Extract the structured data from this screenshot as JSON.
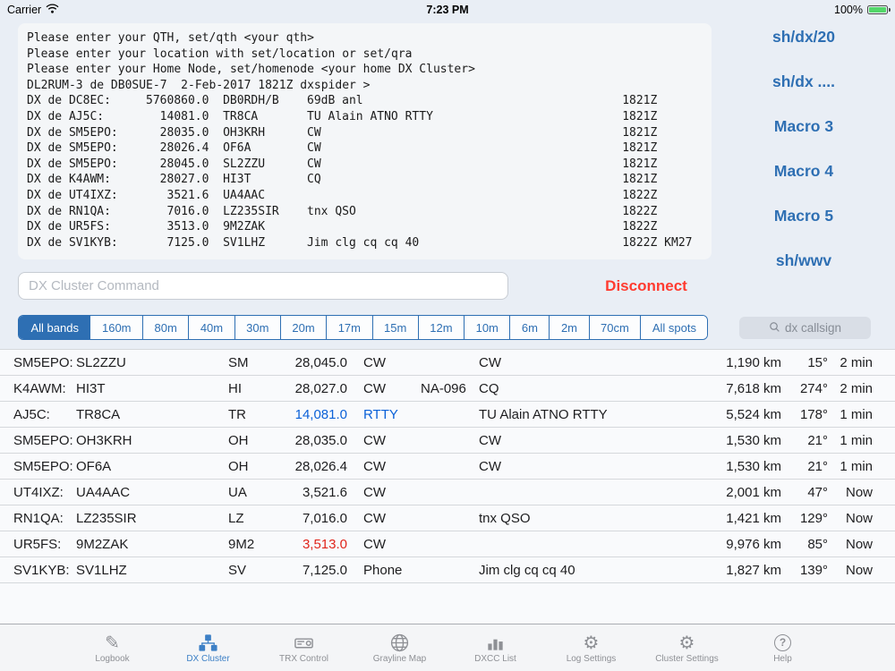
{
  "status_bar": {
    "carrier": "Carrier",
    "time": "7:23 PM",
    "battery_percent": "100%"
  },
  "terminal": {
    "intro_lines": [
      "Please enter your QTH, set/qth <your qth>",
      "Please enter your location with set/location or set/qra",
      "Please enter your Home Node, set/homenode <your home DX Cluster>",
      "DL2RUM-3 de DB0SUE-7  2-Feb-2017 1821Z dxspider >"
    ],
    "spot_lines": [
      {
        "head": "DX de DC8EC:",
        "freq": "5760860.0",
        "dx": "DB0RDH/B",
        "comment": "69dB anl",
        "time": "1821Z"
      },
      {
        "head": "DX de AJ5C:",
        "freq": "14081.0",
        "dx": "TR8CA",
        "comment": "TU Alain ATNO RTTY",
        "time": "1821Z"
      },
      {
        "head": "DX de SM5EPO:",
        "freq": "28035.0",
        "dx": "OH3KRH",
        "comment": "CW",
        "time": "1821Z"
      },
      {
        "head": "DX de SM5EPO:",
        "freq": "28026.4",
        "dx": "OF6A",
        "comment": "CW",
        "time": "1821Z"
      },
      {
        "head": "DX de SM5EPO:",
        "freq": "28045.0",
        "dx": "SL2ZZU",
        "comment": "CW",
        "time": "1821Z"
      },
      {
        "head": "DX de K4AWM:",
        "freq": "28027.0",
        "dx": "HI3T",
        "comment": "CQ",
        "time": "1821Z"
      },
      {
        "head": "DX de UT4IXZ:",
        "freq": "3521.6",
        "dx": "UA4AAC",
        "comment": "",
        "time": "1822Z"
      },
      {
        "head": "DX de RN1QA:",
        "freq": "7016.0",
        "dx": "LZ235SIR",
        "comment": "tnx QSO",
        "time": "1822Z"
      },
      {
        "head": "DX de UR5FS:",
        "freq": "3513.0",
        "dx": "9M2ZAK",
        "comment": "",
        "time": "1822Z"
      },
      {
        "head": "DX de SV1KYB:",
        "freq": "7125.0",
        "dx": "SV1LHZ",
        "comment": "Jim clg cq cq 40",
        "time": "1822Z KM27"
      }
    ]
  },
  "macro_panel": {
    "buttons": [
      "sh/dx/20",
      "sh/dx ....",
      "Macro 3",
      "Macro 4",
      "Macro 5",
      "sh/wwv"
    ]
  },
  "command_bar": {
    "input_value": "",
    "input_placeholder": "DX Cluster Command",
    "disconnect_label": "Disconnect"
  },
  "band_filter": {
    "segments": [
      {
        "label": "All bands",
        "active": true
      },
      {
        "label": "160m"
      },
      {
        "label": "80m"
      },
      {
        "label": "40m"
      },
      {
        "label": "30m"
      },
      {
        "label": "20m"
      },
      {
        "label": "17m"
      },
      {
        "label": "15m"
      },
      {
        "label": "12m"
      },
      {
        "label": "10m"
      },
      {
        "label": "6m"
      },
      {
        "label": "2m"
      },
      {
        "label": "70cm"
      },
      {
        "label": "All spots"
      }
    ]
  },
  "search": {
    "placeholder": "dx callsign"
  },
  "spots_table": {
    "rows": [
      {
        "spotter": "SM5EPO:",
        "dx": "SL2ZZU",
        "prefix": "SM",
        "freq": "28,045.0",
        "mode": "CW",
        "iota": "",
        "comment": "CW",
        "distance": "1,190 km",
        "bearing": "15°",
        "age": "2 min"
      },
      {
        "spotter": "K4AWM:",
        "dx": "HI3T",
        "prefix": "HI",
        "freq": "28,027.0",
        "mode": "CW",
        "iota": "NA-096",
        "comment": "CQ",
        "distance": "7,618 km",
        "bearing": "274°",
        "age": "2 min"
      },
      {
        "spotter": "AJ5C:",
        "dx": "TR8CA",
        "prefix": "TR",
        "freq": "14,081.0",
        "freq_hl": "blue",
        "mode": "RTTY",
        "mode_hl": "blue",
        "iota": "",
        "comment": "TU Alain ATNO RTTY",
        "distance": "5,524 km",
        "bearing": "178°",
        "age": "1 min"
      },
      {
        "spotter": "SM5EPO:",
        "dx": "OH3KRH",
        "prefix": "OH",
        "freq": "28,035.0",
        "mode": "CW",
        "iota": "",
        "comment": "CW",
        "distance": "1,530 km",
        "bearing": "21°",
        "age": "1 min"
      },
      {
        "spotter": "SM5EPO:",
        "dx": "OF6A",
        "prefix": "OH",
        "freq": "28,026.4",
        "mode": "CW",
        "iota": "",
        "comment": "CW",
        "distance": "1,530 km",
        "bearing": "21°",
        "age": "1 min"
      },
      {
        "spotter": "UT4IXZ:",
        "dx": "UA4AAC",
        "prefix": "UA",
        "freq": "3,521.6",
        "mode": "CW",
        "iota": "",
        "comment": "",
        "distance": "2,001 km",
        "bearing": "47°",
        "age": "Now"
      },
      {
        "spotter": "RN1QA:",
        "dx": "LZ235SIR",
        "prefix": "LZ",
        "freq": "7,016.0",
        "mode": "CW",
        "iota": "",
        "comment": "tnx QSO",
        "distance": "1,421 km",
        "bearing": "129°",
        "age": "Now"
      },
      {
        "spotter": "UR5FS:",
        "dx": "9M2ZAK",
        "prefix": "9M2",
        "freq": "3,513.0",
        "freq_hl": "red",
        "mode": "CW",
        "iota": "",
        "comment": "",
        "distance": "9,976 km",
        "bearing": "85°",
        "age": "Now"
      },
      {
        "spotter": "SV1KYB:",
        "dx": "SV1LHZ",
        "prefix": "SV",
        "freq": "7,125.0",
        "mode": "Phone",
        "iota": "",
        "comment": "Jim clg cq cq 40",
        "distance": "1,827 km",
        "bearing": "139°",
        "age": "Now"
      }
    ]
  },
  "tab_bar": {
    "items": [
      {
        "label": "Logbook",
        "icon": "pencil"
      },
      {
        "label": "DX Cluster",
        "icon": "cluster",
        "active": true
      },
      {
        "label": "TRX Control",
        "icon": "trx"
      },
      {
        "label": "Grayline Map",
        "icon": "globe"
      },
      {
        "label": "DXCC List",
        "icon": "barchart"
      },
      {
        "label": "Log Settings",
        "icon": "gear"
      },
      {
        "label": "Cluster Settings",
        "icon": "gear"
      },
      {
        "label": "Help",
        "icon": "help"
      }
    ]
  },
  "colors": {
    "accent_blue": "#2e6fb3",
    "active_tab_blue": "#3d80c6",
    "alert_red": "#ff3b30",
    "highlight_blue": "#0b61d8",
    "highlight_red": "#e0251b",
    "battery_green": "#53d769"
  }
}
